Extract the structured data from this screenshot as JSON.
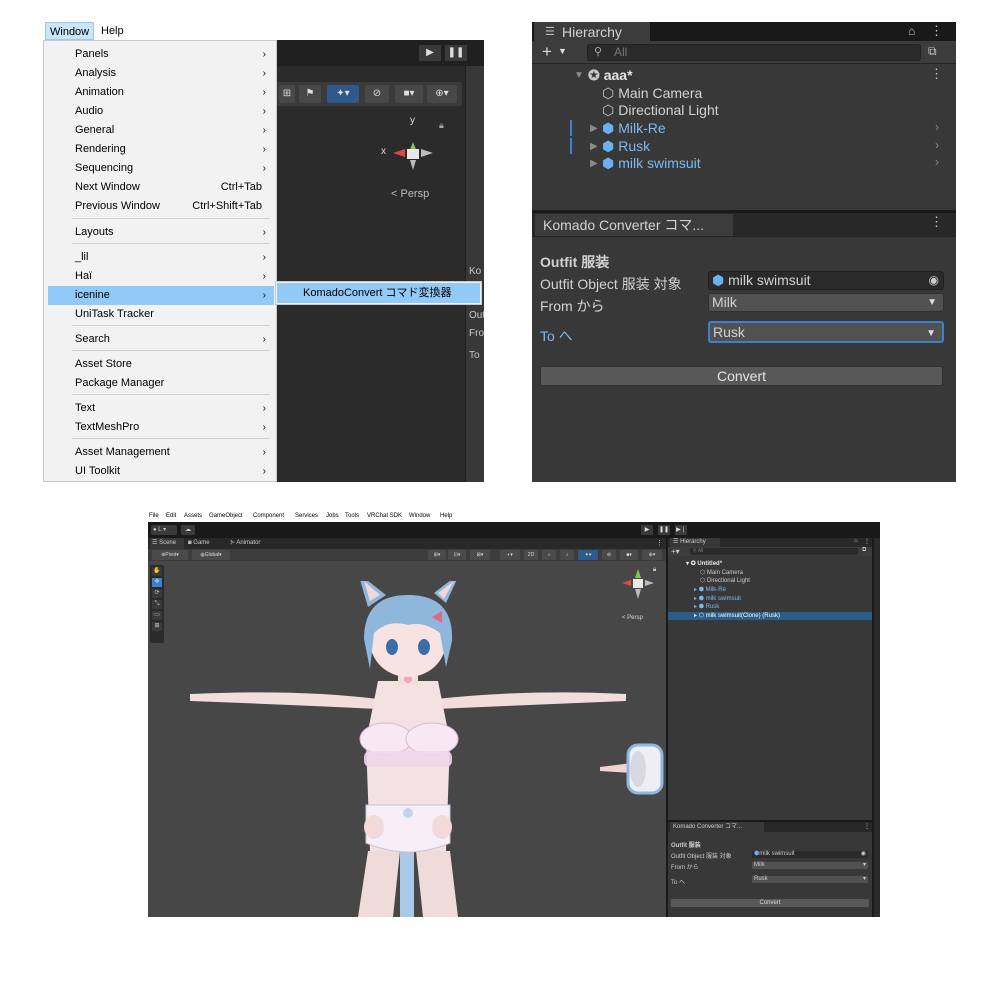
{
  "panel1": {
    "menubar": [
      "Window",
      "Help"
    ],
    "menu_items": [
      {
        "label": "Panels",
        "submenu": true
      },
      {
        "label": "Analysis",
        "submenu": true
      },
      {
        "label": "Animation",
        "submenu": true
      },
      {
        "label": "Audio",
        "submenu": true
      },
      {
        "label": "General",
        "submenu": true
      },
      {
        "label": "Rendering",
        "submenu": true
      },
      {
        "label": "Sequencing",
        "submenu": true
      },
      {
        "label": "Next Window",
        "shortcut": "Ctrl+Tab"
      },
      {
        "label": "Previous Window",
        "shortcut": "Ctrl+Shift+Tab"
      },
      {
        "label": "Layouts",
        "submenu": true
      },
      {
        "label": "_lil",
        "submenu": true
      },
      {
        "label": "Haï",
        "submenu": true
      },
      {
        "label": "icenine",
        "submenu": true,
        "highlighted": true
      },
      {
        "label": "UniTask Tracker"
      },
      {
        "label": "Search",
        "submenu": true
      },
      {
        "label": "Asset Store"
      },
      {
        "label": "Package Manager"
      },
      {
        "label": "Text",
        "submenu": true
      },
      {
        "label": "TextMeshPro",
        "submenu": true
      },
      {
        "label": "Asset Management",
        "submenu": true
      },
      {
        "label": "UI Toolkit",
        "submenu": true
      }
    ],
    "submenu_item": "KomadoConvert コマド変換器",
    "persp_label": "< Persp",
    "gizmo_y": "y",
    "gizmo_x": "x",
    "right_column": [
      "Ko",
      "Out",
      "Fro",
      "To"
    ],
    "play_icons": [
      "play-icon",
      "pause-icon"
    ]
  },
  "panel2": {
    "hierarchy_tab": "Hierarchy",
    "search_placeholder": "All",
    "scene_name": "aaa*",
    "items": [
      {
        "label": "Main Camera",
        "prefab": false
      },
      {
        "label": "Directional Light",
        "prefab": false
      },
      {
        "label": "Milk-Re",
        "prefab": true
      },
      {
        "label": "Rusk",
        "prefab": true
      },
      {
        "label": "milk swimsuit",
        "prefab": true
      }
    ],
    "komado_tab": "Komado Converter コマ...",
    "section_title": "Outfit 服装",
    "outfit_label": "Outfit Object 服装 対象",
    "outfit_value": "milk swimsuit",
    "from_label": "From から",
    "from_value": "Milk",
    "to_label": "To へ",
    "to_value": "Rusk",
    "convert_label": "Convert"
  },
  "panel3": {
    "menubar": [
      "File",
      "Edit",
      "Assets",
      "GameObject",
      "Component",
      "Services",
      "Jobs",
      "Tools",
      "VRChat SDK",
      "Window",
      "Help"
    ],
    "account_label": "L",
    "scene_tabs": [
      "Scene",
      "Game",
      "Animator"
    ],
    "pivot_label": "Pivot",
    "global_label": "Global",
    "persp_label": "< Persp",
    "hierarchy_tab": "Hierarchy",
    "search_placeholder": "All",
    "scene_name": "Untitled*",
    "items": [
      {
        "label": "Main Camera",
        "prefab": false
      },
      {
        "label": "Directional Light",
        "prefab": false
      },
      {
        "label": "Milk-Re",
        "prefab": true
      },
      {
        "label": "milk swimsuit",
        "prefab": true
      },
      {
        "label": "Rusk",
        "prefab": true
      },
      {
        "label": "milk swimsuit(Clone) (Rusk)",
        "prefab": false,
        "selected": true
      }
    ],
    "komado_tab": "Komado Converter コマ...",
    "section_title": "Outfit 服装",
    "outfit_label": "Outfit Object 服装 対象",
    "outfit_value": "milk swimsuit",
    "from_label": "From から",
    "from_value": "Milk",
    "to_label": "To へ",
    "to_value": "Rusk",
    "convert_label": "Convert",
    "toolbar_2d": "2D"
  },
  "colors": {
    "menu_highlight": "#91c9f7",
    "editor_dark": "#383838",
    "prefab_blue": "#7cb9f2",
    "selection_blue": "#2c5d87",
    "focus_blue": "#3d7fd1"
  }
}
